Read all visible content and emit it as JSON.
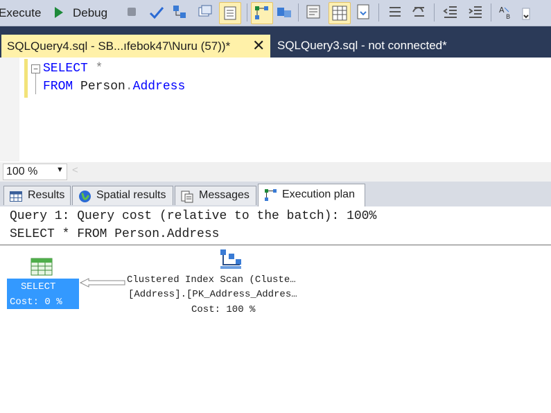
{
  "toolbar": {
    "execute_label": "Execute",
    "debug_label": "Debug"
  },
  "tabs": {
    "active": "SQLQuery4.sql - SB...ıfebok47\\Nuru (57))*",
    "inactive": "SQLQuery3.sql - not connected*"
  },
  "editor": {
    "line1_kw": "SELECT",
    "line1_rest": "*",
    "line2_kw": "FROM",
    "line2_schema": "Person",
    "line2_dot": ".",
    "line2_table": "Address"
  },
  "zoom": {
    "value": "100 %"
  },
  "result_tabs": {
    "results": "Results",
    "spatial": "Spatial results",
    "messages": "Messages",
    "plan": "Execution plan"
  },
  "plan": {
    "query_header": "Query 1: Query cost (relative to the batch): 100%",
    "query_text": "SELECT * FROM Person.Address",
    "select_node": {
      "title": "SELECT",
      "cost": "Cost: 0 %"
    },
    "scan_node": {
      "line1": "Clustered Index Scan (Cluste…",
      "line2": "[Address].[PK_Address_Addres…",
      "line3": "Cost: 100 %"
    }
  },
  "colors": {
    "accent_tab": "#fff1a9",
    "tabstrip": "#2b3a58",
    "keyword": "#0000ff",
    "selected_node": "#3399ff"
  },
  "icons": [
    "play-icon",
    "stop-icon",
    "checkmark-icon",
    "parse-icon",
    "results-grid-icon",
    "execution-plan-icon",
    "spatial-globe-icon",
    "messages-icon",
    "table-icon",
    "clustered-index-scan-icon"
  ]
}
